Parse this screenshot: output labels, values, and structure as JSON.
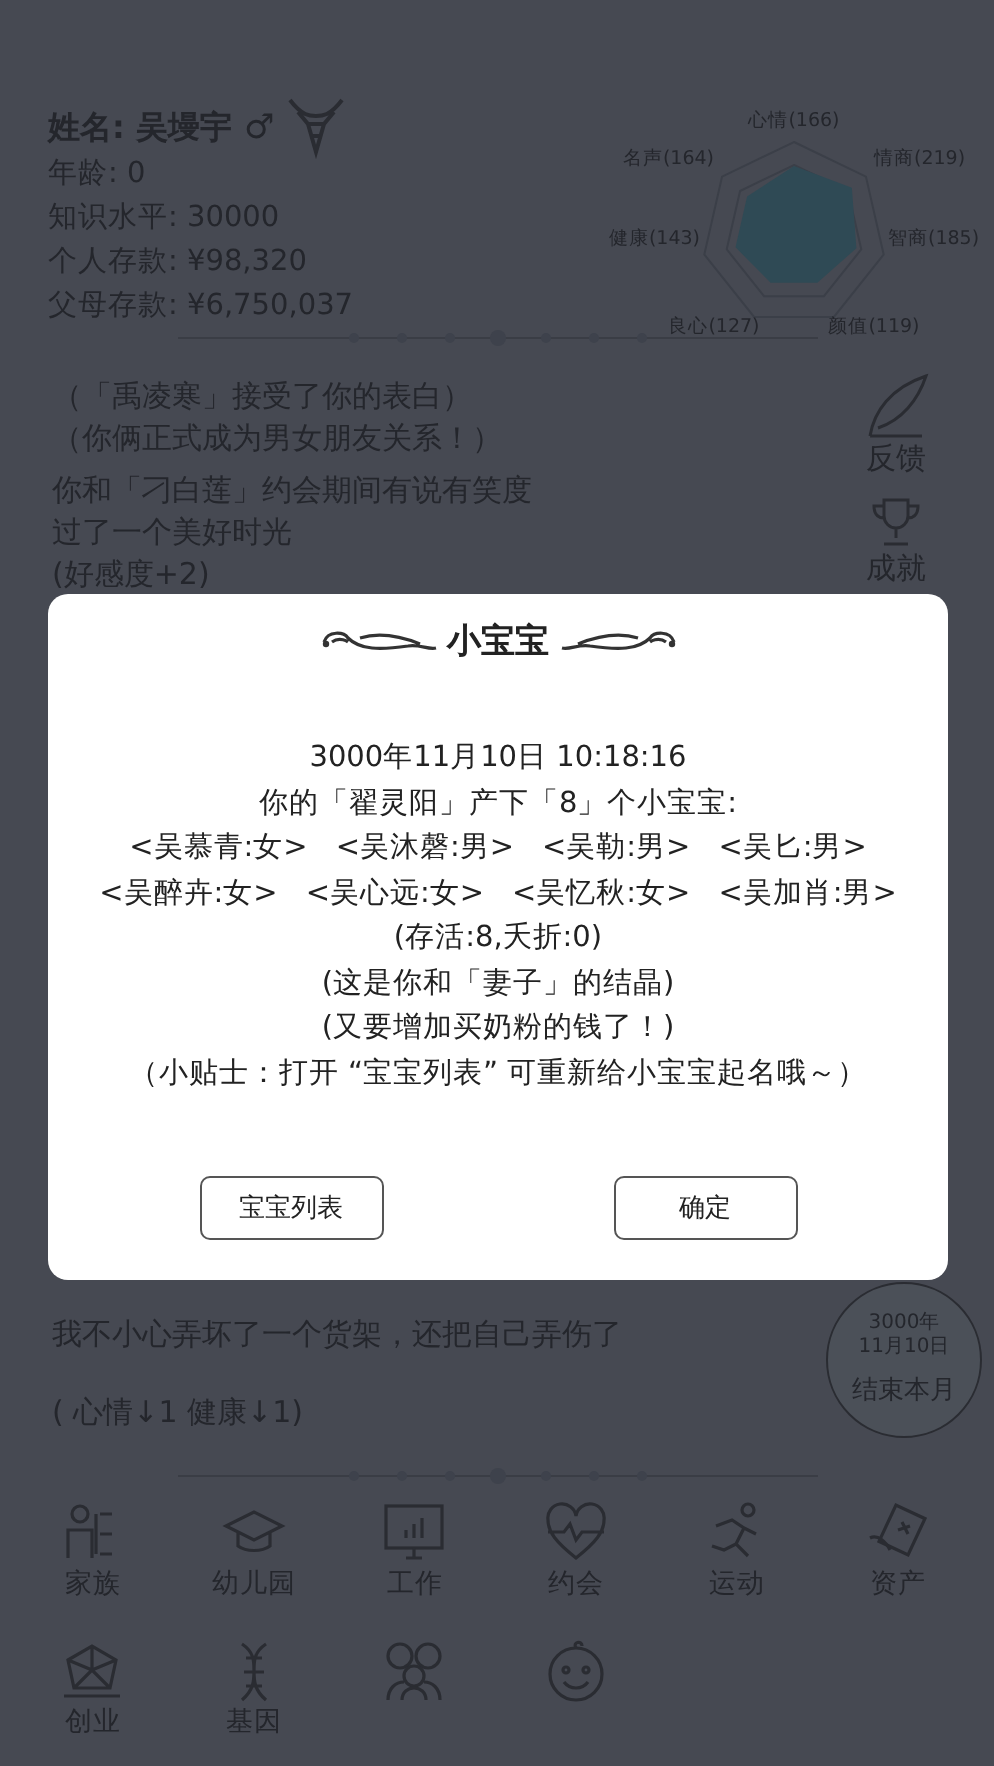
{
  "profile": {
    "name": "姓名: 吴墁宇",
    "gender": "♂",
    "stats": [
      "年龄: 0",
      "知识水平: 30000",
      "个人存款: ¥98,320",
      "父母存款: ¥6,750,037"
    ]
  },
  "attributes": [
    "心情(166)",
    "情商(219)",
    "智商(185)",
    "颜值(119)",
    "良心(127)",
    "健康(143)",
    "名声(164)"
  ],
  "log_top": [
    "（「禹凌寒」接受了你的表白）",
    "（你俩正式成为男女朋友关系！）",
    "你和「刁白莲」约会期间有说有笑度过了一个美好时光",
    "(好感度+2)"
  ],
  "log_bottom": [
    "我不小心弄坏了一个货架，还把自己弄伤了",
    "( 心情↓1 健康↓1)"
  ],
  "side_buttons": [
    "反馈",
    "成就"
  ],
  "end_month": {
    "date": "3000年 11月10日",
    "label": "结束本月"
  },
  "menu": [
    "家族",
    "幼儿园",
    "工作",
    "约会",
    "运动",
    "资产",
    "创业",
    "基因"
  ],
  "dialog": {
    "title": "小宝宝",
    "lines_before": [
      "3000年11月10日 10:18:16",
      "你的「翟灵阳」产下「8」个小宝宝:"
    ],
    "babies": [
      [
        "<吴慕青:女>",
        "<吴沐磬:男>",
        "<吴勒:男>",
        "<吴匕:男>"
      ],
      [
        "<吴醉卉:女>",
        "<吴心远:女>",
        "<吴忆秋:女>",
        "<吴加肖:男>"
      ]
    ],
    "lines_after": [
      "(存活:8,夭折:0)",
      "(这是你和「妻子」的结晶)",
      "(又要增加买奶粉的钱了！)",
      "（小贴士：打开 “宝宝列表” 可重新给小宝宝起名哦～）"
    ],
    "buttons": [
      "宝宝列表",
      "确定"
    ]
  }
}
